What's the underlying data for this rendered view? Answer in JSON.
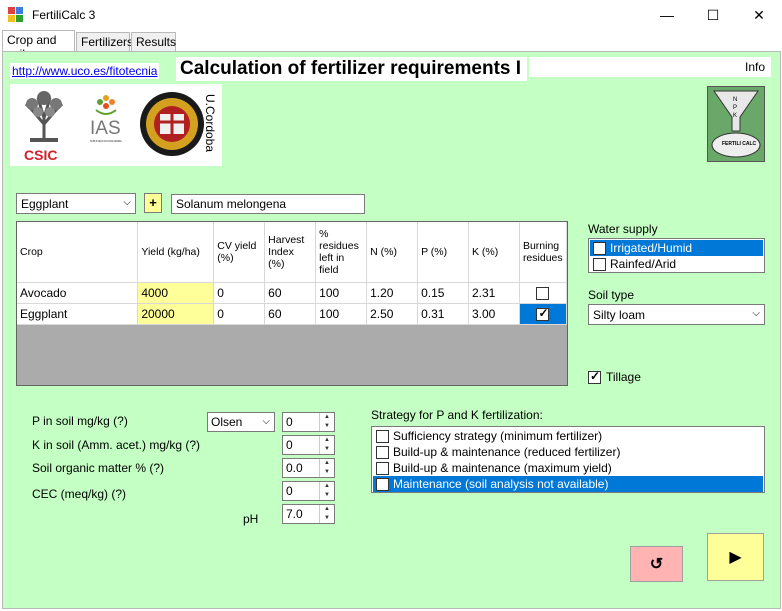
{
  "window": {
    "title": "FertiliCalc 3",
    "minimize_glyph": "—",
    "maximize_glyph": "☐",
    "close_glyph": "✕"
  },
  "tabs": [
    "Crop and soil",
    "Fertilizers",
    "Results"
  ],
  "header": {
    "link": "http://www.uco.es/fitotecnia",
    "title": "Calculation of fertilizer requirements I",
    "info": "Info"
  },
  "logos": {
    "csic": "CSIC",
    "ias": "IAS",
    "ias_sub": "INSTITUTO DE AGRICULTURA SOSTENIBLE",
    "ucordoba": "U.Cordoba",
    "npk_letters": [
      "N",
      "P",
      "K"
    ],
    "npk_name": "FERTILI CALC"
  },
  "crop_select": {
    "value": "Eggplant",
    "add_label": "+",
    "scientific_name": "Solanum melongena"
  },
  "crop_table": {
    "headers": [
      "Crop",
      "Yield (kg/ha)",
      "CV yield (%)",
      "Harvest Index (%)",
      "% residues left in field",
      "N (%)",
      "P (%)",
      "K (%)",
      "Burning residues"
    ],
    "rows": [
      {
        "crop": "Avocado",
        "yield": "4000",
        "cv": "0",
        "hi": "60",
        "residues": "100",
        "n": "1.20",
        "p": "0.15",
        "k": "2.31",
        "burning": false
      },
      {
        "crop": "Eggplant",
        "yield": "20000",
        "cv": "0",
        "hi": "60",
        "residues": "100",
        "n": "2.50",
        "p": "0.31",
        "k": "3.00",
        "burning": true
      }
    ]
  },
  "water_supply": {
    "label": "Water supply",
    "options": [
      {
        "label": "Irrigated/Humid",
        "checked": true
      },
      {
        "label": "Rainfed/Arid",
        "checked": false
      }
    ]
  },
  "soil_type": {
    "label": "Soil type",
    "value": "Silty loam"
  },
  "tillage": {
    "label": "Tillage",
    "checked": true
  },
  "soil_inputs": {
    "p_label": "P in soil mg/kg (?)",
    "p_method": "Olsen",
    "p_value": "0",
    "k_label": "K in soil (Amm. acet.) mg/kg (?)",
    "k_value": "0",
    "om_label": "Soil organic matter % (?)",
    "om_value": "0.0",
    "cec_label": "CEC (meq/kg) (?)",
    "cec_value": "0",
    "ph_label": "pH",
    "ph_value": "7.0"
  },
  "strategy": {
    "label": "Strategy for P and K fertilization:",
    "options": [
      {
        "label": "Sufficiency strategy (minimum fertilizer)",
        "checked": false
      },
      {
        "label": "Build-up & maintenance (reduced fertilizer)",
        "checked": false
      },
      {
        "label": "Build-up & maintenance (maximum yield)",
        "checked": false
      },
      {
        "label": "Maintenance (soil analysis not available)",
        "checked": true
      }
    ]
  },
  "actions": {
    "reset_glyph": "↺",
    "run_glyph": "▶"
  }
}
